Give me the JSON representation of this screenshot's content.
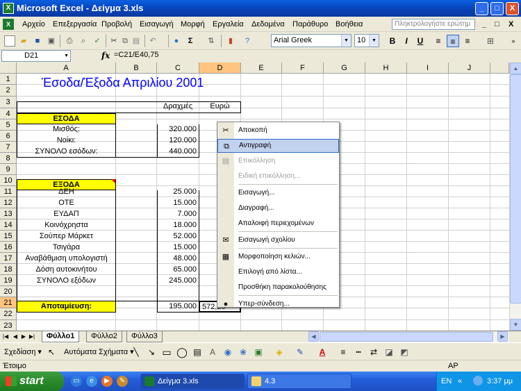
{
  "window": {
    "title": "Microsoft Excel - Δείγμα 3.xls",
    "app_icon": "excel-icon",
    "controls": {
      "minimize": "_",
      "maximize": "□",
      "close": "X"
    }
  },
  "menubar": {
    "items": [
      "Αρχείο",
      "Επεξεργασία",
      "Προβολή",
      "Εισαγωγή",
      "Μορφή",
      "Εργαλεία",
      "Δεδομένα",
      "Παράθυρο",
      "Βοήθεια"
    ],
    "help_placeholder": "Πληκτρολογήστε ερώτημ",
    "mdi": {
      "minimize": "_",
      "restore": "□",
      "close": "X"
    }
  },
  "toolbar": {
    "font": "Arial Greek",
    "font_size": "10",
    "bold": "B",
    "italic": "I",
    "underline": "U",
    "sigma": "Σ"
  },
  "formula_bar": {
    "name_box": "D21",
    "fx": "fx",
    "formula": "=C21/E40,75"
  },
  "sheet": {
    "columns": [
      "A",
      "B",
      "C",
      "D",
      "E",
      "F",
      "G",
      "H",
      "I",
      "J"
    ],
    "rows": [
      "1",
      "2",
      "3",
      "4",
      "5",
      "6",
      "7",
      "8",
      "9",
      "10",
      "11",
      "12",
      "13",
      "14",
      "15",
      "16",
      "17",
      "18",
      "19",
      "20",
      "21",
      "22",
      "23"
    ],
    "title": "Έσοδα/Έξοδα Απριλίου 2001",
    "header_c": "Δραχμές",
    "header_d": "Ευρώ",
    "income_header": "ΕΣΟΔΑ",
    "income": [
      {
        "label": "Μισθός:",
        "value": "320.000"
      },
      {
        "label": "Νοίκι:",
        "value": "120.000"
      },
      {
        "label": "ΣΥΝΟΛΟ εσόδων:",
        "value": "440.000"
      }
    ],
    "expense_header": "ΕΞΟΔΑ",
    "expenses": [
      {
        "label": "ΔΕΗ",
        "value": "25.000"
      },
      {
        "label": "ΟΤΕ",
        "value": "15.000"
      },
      {
        "label": "ΕΥΔΑΠ",
        "value": "7.000"
      },
      {
        "label": "Κοινόχρηστα",
        "value": "18.000"
      },
      {
        "label": "Σούπερ Μάρκετ",
        "value": "52.000"
      },
      {
        "label": "Τσιγάρα",
        "value": "15.000"
      },
      {
        "label": "Αναβάθμιση υπολογιστή",
        "value": "48.000"
      },
      {
        "label": "Δόση αυτοκινήτου",
        "value": "65.000"
      },
      {
        "label": "ΣΥΝΟΛΟ εξόδων",
        "value": "245.000"
      }
    ],
    "savings_label": "Αποταμίευση:",
    "savings_value": "195.000",
    "savings_euro": "572,25"
  },
  "context_menu": {
    "items": [
      {
        "label": "Αποκοπή",
        "icon": "scissors-icon",
        "state": "normal"
      },
      {
        "label": "Αντιγραφή",
        "icon": "copy-icon",
        "state": "highlighted"
      },
      {
        "label": "Επικόλληση",
        "icon": "paste-icon",
        "state": "disabled"
      },
      {
        "label": "Ειδική επικόλληση...",
        "icon": "",
        "state": "disabled"
      },
      {
        "label": "Εισαγωγή...",
        "icon": "",
        "state": "normal"
      },
      {
        "label": "Διαγραφή...",
        "icon": "",
        "state": "normal"
      },
      {
        "label": "Απαλοιφή περιεχομένων",
        "icon": "",
        "state": "normal"
      },
      {
        "label": "Εισαγωγή σχολίου",
        "icon": "comment-icon",
        "state": "normal"
      },
      {
        "label": "Μορφοποίηση κελιών...",
        "icon": "format-cells-icon",
        "state": "normal"
      },
      {
        "label": "Επιλογή από λίστα...",
        "icon": "",
        "state": "normal"
      },
      {
        "label": "Προσθήκη παρακολούθησης",
        "icon": "",
        "state": "normal"
      },
      {
        "label": "Υπερ-σύνδεση...",
        "icon": "hyperlink-icon",
        "state": "normal"
      }
    ]
  },
  "sheet_tabs": [
    "Φύλλο1",
    "Φύλλο2",
    "Φύλλο3"
  ],
  "drawbar": {
    "draw": "Σχεδίαση",
    "autoshapes": "Αυτόματα Σχήματα"
  },
  "statusbar": {
    "left": "Έτοιμο",
    "right": "ΑΡ"
  },
  "taskbar": {
    "start": "start",
    "tasks": [
      "Δείγμα 3.xls",
      "4.3"
    ],
    "language": "EN",
    "time": "3:37 μμ"
  },
  "colors": {
    "title_blue": "#0000ff",
    "highlight_yellow": "#ffff00",
    "selection_orange": "#ffc580"
  }
}
